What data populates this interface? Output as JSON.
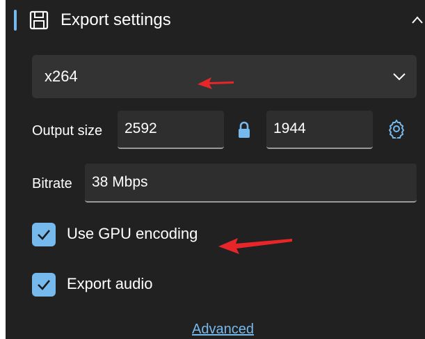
{
  "section": {
    "title": "Export settings",
    "icon": "save-icon",
    "accent_color": "#76b9ed"
  },
  "encoder": {
    "selected": "x264",
    "icon": "chevron-down-icon"
  },
  "output_size": {
    "label": "Output size",
    "width": "2592",
    "height": "1944",
    "lock_icon": "lock-icon",
    "settings_icon": "gear-icon"
  },
  "bitrate": {
    "label": "Bitrate",
    "value": "38 Mbps"
  },
  "options": [
    {
      "label": "Use GPU encoding",
      "checked": true
    },
    {
      "label": "Export audio",
      "checked": true
    }
  ],
  "advanced_link": "Advanced",
  "colors": {
    "panel_bg": "#212121",
    "field_bg": "#2e2e2e",
    "accent": "#76b9ed",
    "annotation_arrow": "#e8262a"
  }
}
